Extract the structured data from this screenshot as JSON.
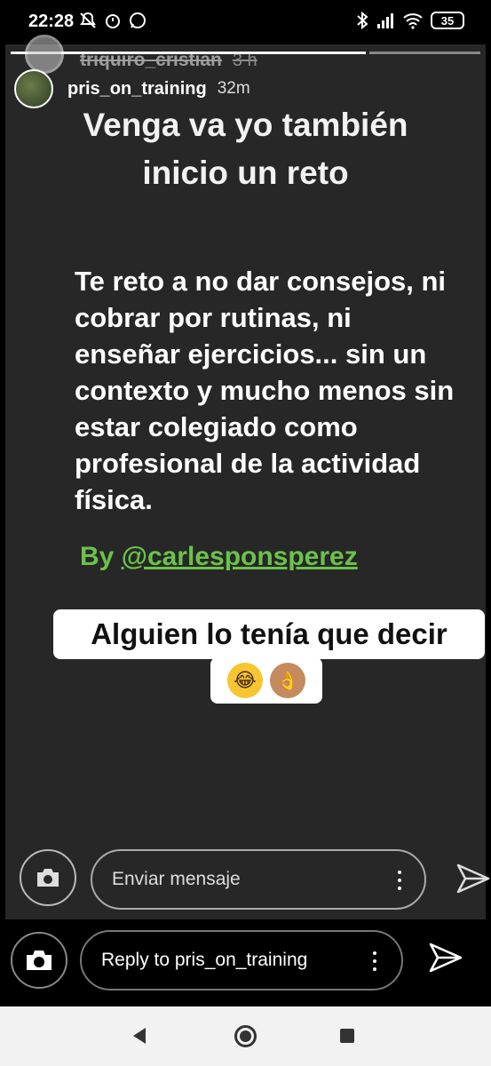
{
  "status_bar": {
    "time": "22:28",
    "battery": "35"
  },
  "story": {
    "previous_user": {
      "name": "triquiro_cristian",
      "time": "3 h"
    },
    "user": {
      "name": "pris_on_training",
      "time": "32m"
    },
    "headline_line1": "Venga va yo también",
    "headline_line2": "inicio un reto",
    "body_lines": [
      "Te reto a no dar consejos, ni",
      "cobrar por rutinas, ni",
      "enseñar ejercicios... sin un",
      "contexto y mucho menos sin",
      "estar colegiado como",
      "profesional de la actividad",
      "física."
    ],
    "credit_prefix": "By ",
    "credit_handle": "@carlesponsperez",
    "sticker_text": "Alguien lo tenía que decir",
    "sticker_emojis": [
      "😂",
      "👌"
    ],
    "reply_placeholder": "Enviar mensaje"
  },
  "reply_bar": {
    "placeholder": "Reply to pris_on_training"
  },
  "icons": {
    "camera": "camera-icon",
    "send": "send-icon",
    "more": "more-vertical-icon"
  }
}
